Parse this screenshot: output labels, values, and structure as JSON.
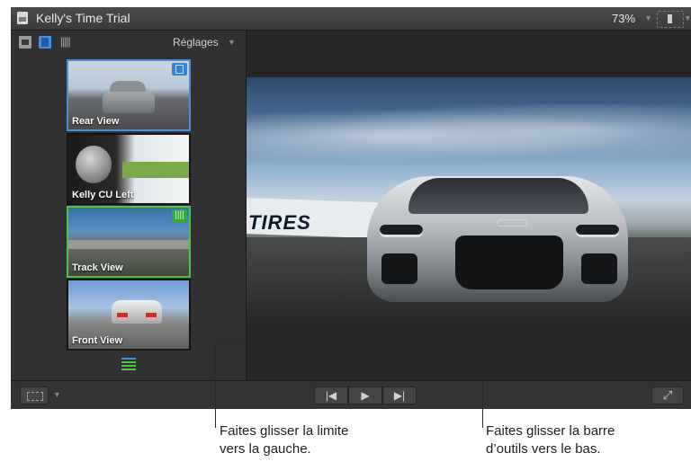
{
  "window": {
    "title": "Kelly's Time Trial",
    "zoom": "73%"
  },
  "sidebar": {
    "settings_label": "Réglages",
    "clips": [
      {
        "label": "Rear View",
        "badge": "video",
        "selected": true
      },
      {
        "label": "Kelly CU Left",
        "badge": "",
        "selected": false
      },
      {
        "label": "Track View",
        "badge": "audio",
        "selected": true
      },
      {
        "label": "Front View",
        "badge": "",
        "selected": false
      }
    ]
  },
  "viewer": {
    "banner_text": "TIRES"
  },
  "icons": {
    "titlebar": "document-icon",
    "sidebar_toolbar": [
      "clip-icon",
      "filmstrip-icon",
      "waveform-icon"
    ],
    "transport": [
      "previous-icon",
      "play-icon",
      "next-icon"
    ],
    "fullscreen": "fullscreen-icon"
  },
  "colors": {
    "video_select": "#4a90d9",
    "audio_select": "#4cc34c"
  },
  "callouts": {
    "left_line1": "Faites glisser la limite",
    "left_line2": "vers la gauche.",
    "right_line1": "Faites glisser la barre",
    "right_line2": "d’outils vers le bas."
  }
}
